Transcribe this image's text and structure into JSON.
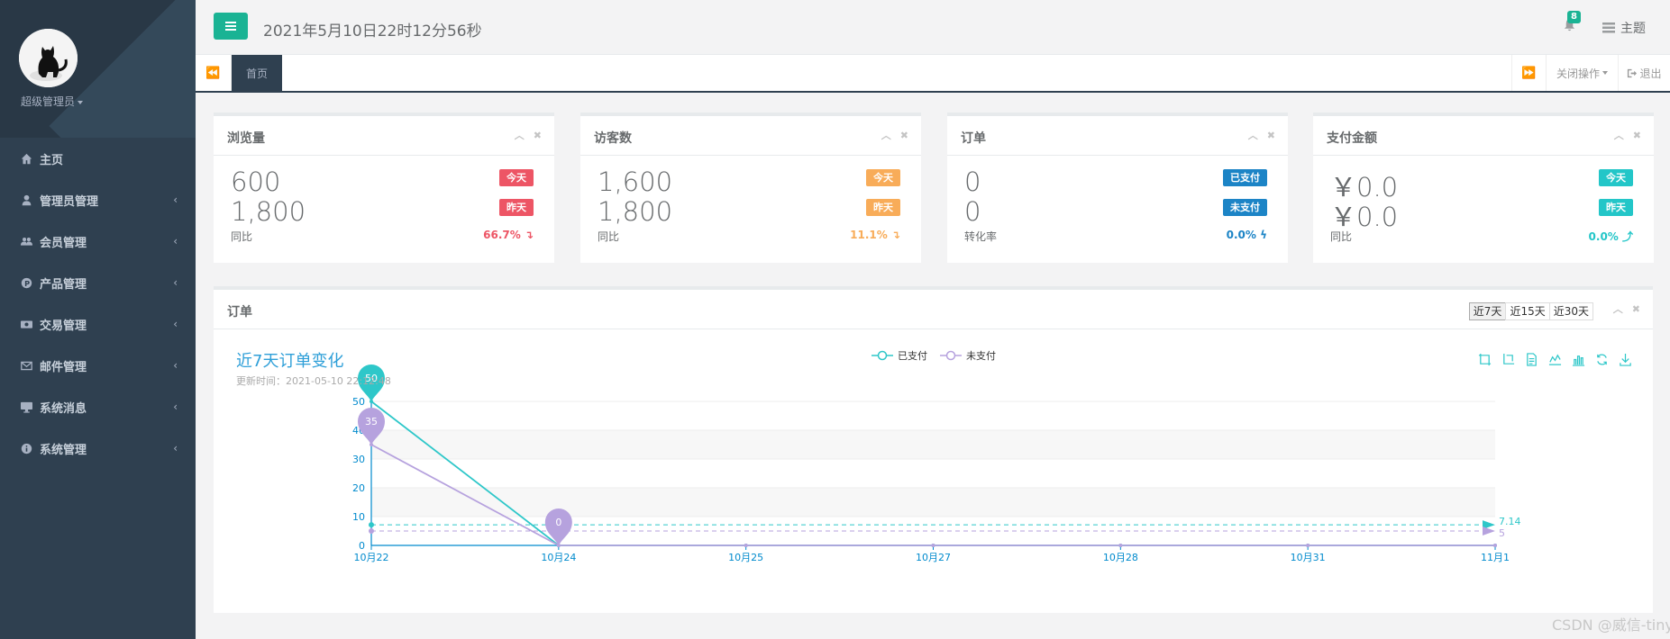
{
  "sidebar": {
    "user_name": "超级管理员",
    "items": [
      {
        "label": "主页",
        "icon": "home-icon"
      },
      {
        "label": "管理员管理",
        "icon": "user-icon"
      },
      {
        "label": "会员管理",
        "icon": "users-icon"
      },
      {
        "label": "产品管理",
        "icon": "product-icon"
      },
      {
        "label": "交易管理",
        "icon": "money-icon"
      },
      {
        "label": "邮件管理",
        "icon": "envelope-icon"
      },
      {
        "label": "系统消息",
        "icon": "desktop-icon"
      },
      {
        "label": "系统管理",
        "icon": "info-icon"
      }
    ],
    "arrow": "‹"
  },
  "topbar": {
    "datetime": "2021年5月10日22时12分56秒",
    "notification_count": "8",
    "theme_label": "主题"
  },
  "tabs": {
    "home": "首页",
    "close_ops": "关闭操作",
    "logout": "退出"
  },
  "cards": [
    {
      "title": "浏览量",
      "value1": "600",
      "value2": "1,800",
      "label1": "今天",
      "label2": "昨天",
      "footer": "同比",
      "pct": "66.7% ↴",
      "color": "#ed5565"
    },
    {
      "title": "访客数",
      "value1": "1,600",
      "value2": "1,800",
      "label1": "今天",
      "label2": "昨天",
      "footer": "同比",
      "pct": "11.1% ↴",
      "color": "#f8ac59"
    },
    {
      "title": "订单",
      "value1": "0",
      "value2": "0",
      "label1": "已支付",
      "label2": "未支付",
      "footer": "转化率",
      "pct": "0.0% ϟ",
      "color": "#1c84c6"
    },
    {
      "title": "支付金额",
      "value1": "￥0.0",
      "value2": "￥0.0",
      "label1": "今天",
      "label2": "昨天",
      "footer": "同比",
      "pct": "0.0% ⤴",
      "color": "#23c6c8"
    }
  ],
  "panel": {
    "title": "订单",
    "range_buttons": [
      "近7天",
      "近15天",
      "近30天"
    ]
  },
  "chart_data": {
    "type": "line",
    "title": "近7天订单变化",
    "subtitle": "更新时间：2021-05-10 22:12:48",
    "categories": [
      "10月22",
      "10月24",
      "10月25",
      "10月27",
      "10月28",
      "10月31",
      "11月1"
    ],
    "ylim": [
      0,
      50
    ],
    "yticks": [
      "0",
      "10",
      "20",
      "30",
      "40",
      "50"
    ],
    "series": [
      {
        "name": "已支付",
        "values": [
          50,
          0,
          0,
          0,
          0,
          0,
          0
        ],
        "color": "#2ec7c9",
        "max_label": "50",
        "average_label": "7.14"
      },
      {
        "name": "未支付",
        "values": [
          35,
          0,
          0,
          0,
          0,
          0,
          0
        ],
        "color": "#b6a2de",
        "max_label": "35",
        "min_label": "0",
        "average_label": "5"
      }
    ],
    "grid": true,
    "legend": "top-center"
  },
  "watermark": "CSDN @威信-tinyfox"
}
